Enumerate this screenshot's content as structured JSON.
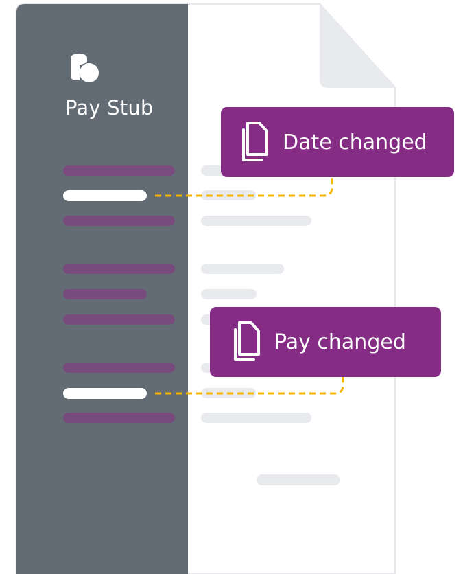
{
  "document": {
    "title": "Pay Stub",
    "icon": "coins-icon"
  },
  "callouts": [
    {
      "label": "Date changed",
      "icon": "copy-documents-icon"
    },
    {
      "label": "Pay changed",
      "icon": "copy-documents-icon"
    }
  ],
  "colors": {
    "sidebar": "#636c75",
    "callout": "#852d85",
    "highlight_line": "#ffffff",
    "purple_line": "#7a4a7e",
    "gray_line": "#e9eaee",
    "connector": "#f5b400",
    "page_border": "#e8e9ed"
  }
}
